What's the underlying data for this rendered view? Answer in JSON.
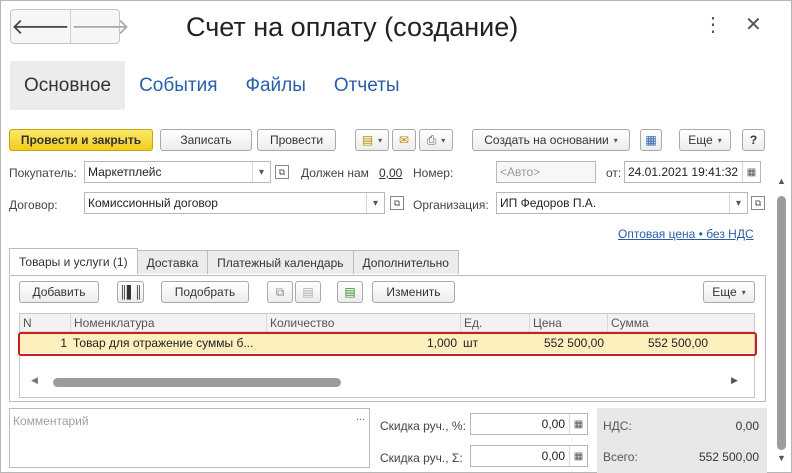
{
  "window": {
    "title": "Счет на оплату (создание)",
    "back_label": "🡐",
    "forward_label": "🡒",
    "more_label": "⋮",
    "close_label": "✕"
  },
  "top_tabs": [
    {
      "label": "Основное"
    },
    {
      "label": "События"
    },
    {
      "label": "Файлы"
    },
    {
      "label": "Отчеты"
    }
  ],
  "toolbar": {
    "post_close": "Провести и закрыть",
    "save": "Записать",
    "post": "Провести",
    "create_based": "Создать на основании",
    "more": "Еще",
    "help": "?"
  },
  "form": {
    "buyer_label": "Покупатель:",
    "buyer_value": "Маркетплейс",
    "owed_label": "Должен нам",
    "owed_value": "0,00",
    "number_label": "Номер:",
    "number_placeholder": "<Авто>",
    "from_label": "от:",
    "date_value": "24.01.2021 19:41:32",
    "contract_label": "Договор:",
    "contract_value": "Комиссионный договор",
    "org_label": "Организация:",
    "org_value": "ИП Федоров П.А.",
    "price_link": "Оптовая цена • без НДС"
  },
  "inner_tabs": [
    {
      "label": "Товары и услуги (1)"
    },
    {
      "label": "Доставка"
    },
    {
      "label": "Платежный календарь"
    },
    {
      "label": "Дополнительно"
    }
  ],
  "table_toolbar": {
    "add": "Добавить",
    "pick": "Подобрать",
    "change": "Изменить",
    "more": "Еще"
  },
  "table": {
    "columns": [
      "N",
      "Номенклатура",
      "Количество",
      "Ед.",
      "Цена",
      "Сумма"
    ],
    "rows": [
      {
        "n": "1",
        "item": "Товар для отражение суммы б...",
        "qty": "1,000",
        "unit": "шт",
        "price": "552 500,00",
        "sum": "552 500,00"
      }
    ]
  },
  "footer": {
    "comment_placeholder": "Комментарий",
    "discount_pct_label": "Скидка руч., %:",
    "discount_pct_value": "0,00",
    "discount_sum_label": "Скидка руч., Σ:",
    "discount_sum_value": "0,00",
    "vat_label": "НДС:",
    "vat_value": "0,00",
    "total_label": "Всего:",
    "total_value": "552 500,00"
  }
}
